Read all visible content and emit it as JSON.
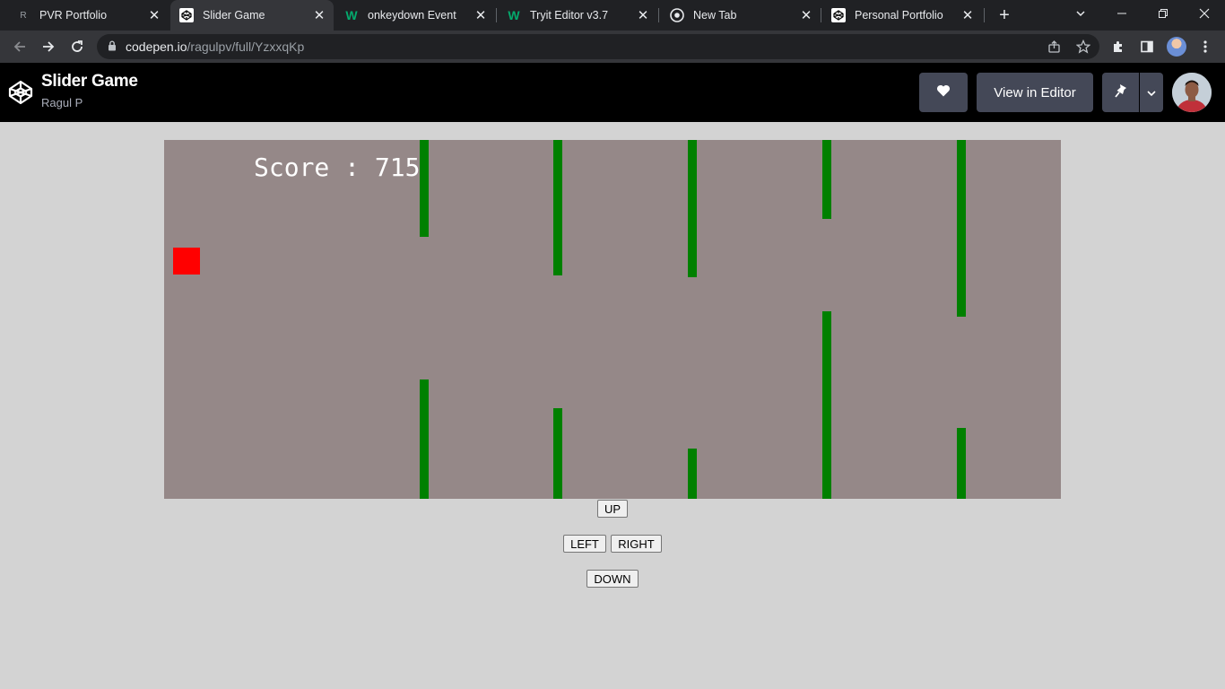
{
  "browser": {
    "tabs": [
      {
        "title": "PVR Portfolio",
        "icon": "generic-favicon-icon",
        "active": false
      },
      {
        "title": "Slider Game",
        "icon": "codepen-favicon-icon",
        "active": true
      },
      {
        "title": "onkeydown Event",
        "icon": "w3schools-favicon-icon",
        "active": false
      },
      {
        "title": "Tryit Editor v3.7",
        "icon": "w3schools-favicon-icon",
        "active": false
      },
      {
        "title": "New Tab",
        "icon": "chrome-favicon-icon",
        "active": false
      },
      {
        "title": "Personal Portfolio",
        "icon": "codepen-favicon-icon",
        "active": false
      }
    ],
    "url_host": "codepen.io",
    "url_path": "/ragulpv/full/YzxxqKp"
  },
  "codepen": {
    "title": "Slider Game",
    "author": "Ragul P",
    "view_editor_label": "View in Editor"
  },
  "game": {
    "score_label": "Score : 715",
    "score": 715,
    "colors": {
      "background": "#958888",
      "player": "#ff0000",
      "pipe": "#008000"
    }
  },
  "controls": {
    "up": "UP",
    "left": "LEFT",
    "right": "RIGHT",
    "down": "DOWN"
  }
}
